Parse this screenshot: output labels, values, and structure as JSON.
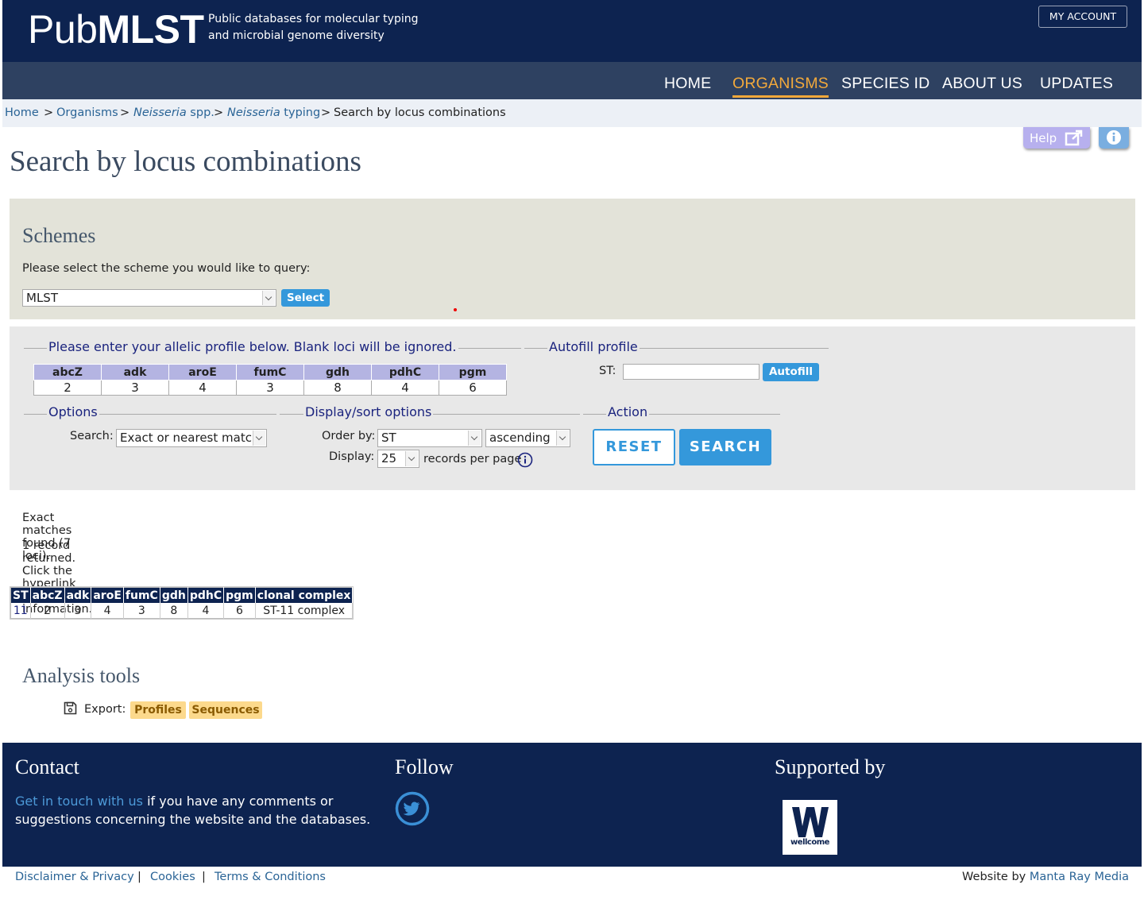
{
  "header": {
    "logo_pub": "Pub",
    "logo_mlst": "MLST",
    "tagline_line1": "Public databases for molecular typing",
    "tagline_line2": "and microbial genome diversity",
    "my_account": "MY ACCOUNT"
  },
  "nav": {
    "items": [
      {
        "label": "HOME"
      },
      {
        "label": "ORGANISMS",
        "active": true
      },
      {
        "label": "SPECIES ID"
      },
      {
        "label": "ABOUT US"
      },
      {
        "label": "UPDATES"
      }
    ],
    "active_color": "#f2a93b"
  },
  "breadcrumb": {
    "home": "Home",
    "organisms": "Organisms",
    "neisseria_italic": "Neisseria",
    "spp": " spp.",
    "typing_italic": "Neisseria",
    "typing": " typing",
    "current": "Search by locus combinations",
    "separator": ">"
  },
  "help": {
    "label": "Help"
  },
  "page_title": "Search by locus combinations",
  "schemes": {
    "heading": "Schemes",
    "prompt": "Please select the scheme you would like to query:",
    "selected": "MLST",
    "select_button": "Select"
  },
  "profile": {
    "legend": "Please enter your allelic profile below. Blank loci will be ignored.",
    "loci": [
      "abcZ",
      "adk",
      "aroE",
      "fumC",
      "gdh",
      "pdhC",
      "pgm"
    ],
    "values": [
      "2",
      "3",
      "4",
      "3",
      "8",
      "4",
      "6"
    ]
  },
  "autofill": {
    "legend": "Autofill profile",
    "st_label": "ST:",
    "st_value": "",
    "button": "Autofill"
  },
  "options": {
    "legend": "Options",
    "search_label": "Search:",
    "search_value": "Exact or nearest match"
  },
  "display": {
    "legend": "Display/sort options",
    "order_label": "Order by:",
    "order_value": "ST",
    "direction_value": "ascending",
    "display_label": "Display:",
    "display_value": "25",
    "records_suffix": "records per page"
  },
  "action": {
    "legend": "Action",
    "reset": "RESET",
    "search": "SEARCH"
  },
  "results": {
    "exact_msg": "Exact matches found (7 loci).",
    "records_msg": "1 record returned. Click the hyperlink for detailed information.",
    "columns": [
      "ST",
      "abcZ",
      "adk",
      "aroE",
      "fumC",
      "gdh",
      "pdhC",
      "pgm",
      "clonal complex"
    ],
    "rows": [
      [
        "11",
        "2",
        "3",
        "4",
        "3",
        "8",
        "4",
        "6",
        "ST-11 complex"
      ]
    ]
  },
  "analysis": {
    "heading": "Analysis tools",
    "export_label": "Export:",
    "profiles": "Profiles",
    "sequences": "Sequences"
  },
  "footer": {
    "contact_heading": "Contact",
    "contact_link": "Get in touch with us",
    "contact_text1": " if you have any comments or",
    "contact_text2": "suggestions concerning the website and the databases.",
    "follow_heading": "Follow",
    "supported_heading": "Supported by",
    "wellcome": "wellcome"
  },
  "bottom": {
    "disclaimer": "Disclaimer & Privacy",
    "cookies": "Cookies",
    "terms": "Terms & Conditions",
    "divider": "|",
    "website_by": "Website by ",
    "manta": "Manta Ray Media"
  },
  "colors": {
    "header_bg": "#0d2350",
    "nav_bg": "#2e4161",
    "link": "#2a6496",
    "button_blue": "#3498db",
    "tag_bg": "#fcd98c"
  }
}
